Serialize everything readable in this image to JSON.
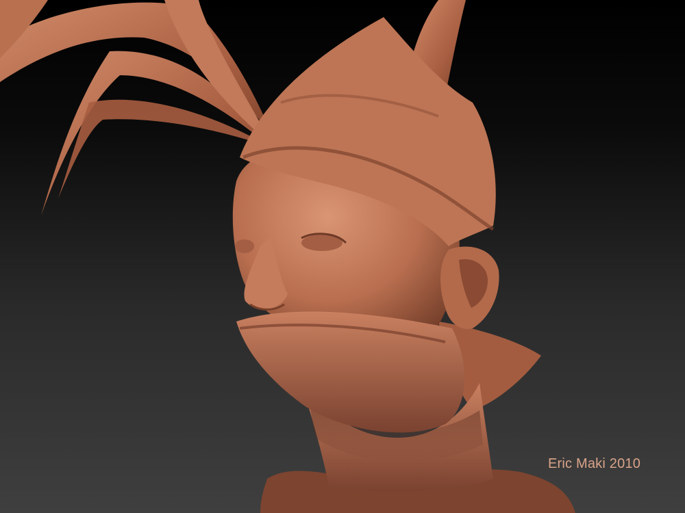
{
  "scene": {
    "subject": "clay-sculpt-head",
    "background_colors": [
      "#000000",
      "#3f3f3f"
    ],
    "clay_color": "#b86e4f"
  },
  "credit": {
    "text": "Eric Maki 2010"
  }
}
